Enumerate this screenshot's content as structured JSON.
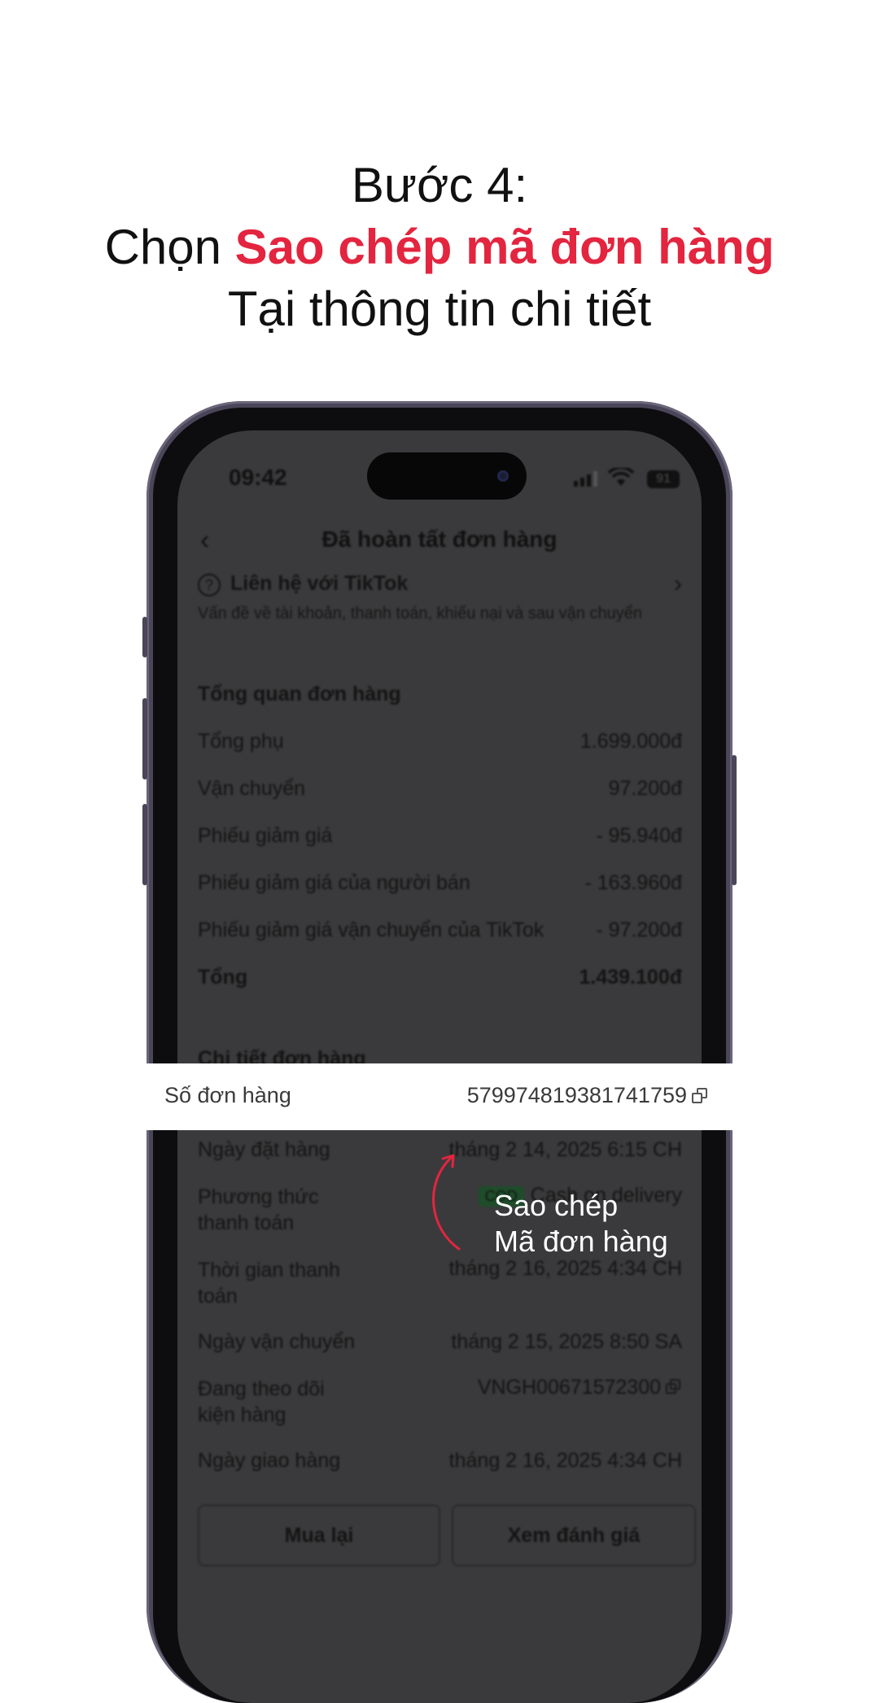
{
  "heading": {
    "line1": "Bước 4:",
    "line2_prefix": "Chọn ",
    "line2_accent": "Sao chép mã đơn hàng",
    "line3": "Tại thông tin chi tiết"
  },
  "colors": {
    "accent": "#e3253f",
    "screen_overlay": "#3a3a3c"
  },
  "status_bar": {
    "time": "09:42",
    "battery": "91"
  },
  "nav": {
    "back_icon": "chevron-left-icon",
    "title": "Đã hoàn tất đơn hàng"
  },
  "contact": {
    "title": "Liên hệ với TikTok",
    "subtitle": "Vấn đề về tài khoản, thanh toán, khiếu nại và sau vận chuyển"
  },
  "overview": {
    "title": "Tổng quan đơn hàng",
    "rows": [
      {
        "label": "Tổng phụ",
        "value": "1.699.000đ"
      },
      {
        "label": "Vận chuyển",
        "value": "97.200đ"
      },
      {
        "label": "Phiếu giảm giá",
        "value": "- 95.940đ"
      },
      {
        "label": "Phiếu giảm giá của người bán",
        "value": "- 163.960đ"
      },
      {
        "label": "Phiếu giảm giá vận chuyển của TikTok",
        "value": "- 97.200đ"
      },
      {
        "label": "Tổng",
        "value": "1.439.100đ"
      }
    ]
  },
  "details": {
    "title": "Chi tiết đơn hàng",
    "order_number_label": "Số đơn hàng",
    "order_number": "579974819381741759",
    "order_date_label": "Ngày đặt hàng",
    "order_date": "tháng 2 14, 2025 6:15 CH",
    "payment_method_label_1": "Phương thức",
    "payment_method_label_2": "thanh toán",
    "payment_badge": "COD",
    "payment_method": "Cash on delivery",
    "payment_time_label_1": "Thời gian thanh",
    "payment_time_label_2": "toán",
    "payment_time": "tháng 2 16, 2025 4:34 CH",
    "ship_date_label": "Ngày vận chuyển",
    "ship_date": "tháng 2 15, 2025 8:50 SA",
    "tracking_label_1": "Đang theo dõi",
    "tracking_label_2": "kiện hàng",
    "tracking": "VNGH00671572300",
    "delivery_date_label": "Ngày giao hàng",
    "delivery_date": "tháng 2 16, 2025 4:34 CH"
  },
  "buttons": {
    "buy_again": "Mua lại",
    "view_review": "Xem đánh giá"
  },
  "annotation": {
    "line1": "Sao chép",
    "line2": "Mã đơn hàng"
  }
}
